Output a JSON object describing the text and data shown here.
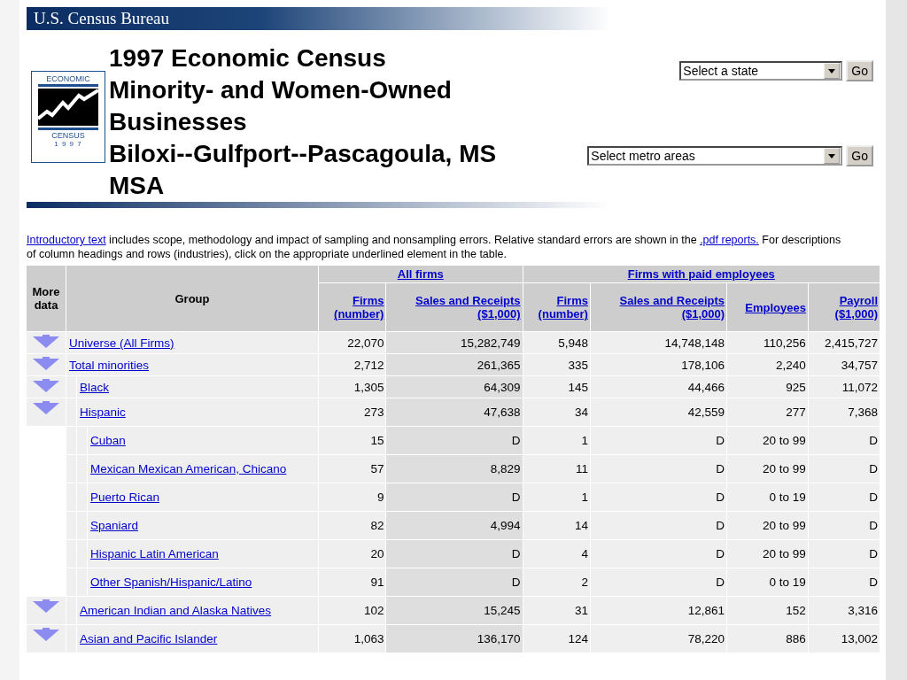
{
  "banner": {
    "title": "U.S. Census Bureau"
  },
  "logo": {
    "top": "ECONOMIC",
    "bottom": "CENSUS",
    "year": "1 9 9 7"
  },
  "title_lines": [
    "1997 Economic Census",
    "Minority- and Women-Owned",
    "Businesses",
    "Biloxi--Gulfport--Pascagoula, MS",
    "MSA"
  ],
  "selectors": [
    {
      "value": "Select a state",
      "button": "Go"
    },
    {
      "value": "Select metro areas",
      "button": "Go"
    }
  ],
  "intro": {
    "link1": "Introductory text",
    "text1": " includes scope, methodology and impact of sampling and nonsampling errors. Relative standard errors are shown in the ",
    "link2": ".pdf reports.",
    "text2": " For descriptions of column headings and rows (industries), click on the appropriate underlined element in the table."
  },
  "table": {
    "more_header": "More data",
    "group_header": "Group",
    "groups": [
      {
        "label": "All firms",
        "columns": [
          {
            "label": "Firms",
            "unit": "(number)"
          },
          {
            "label": "Sales and Receipts",
            "unit": "($1,000)"
          }
        ]
      },
      {
        "label": "Firms with paid employees",
        "columns": [
          {
            "label": "Firms",
            "unit": "(number)"
          },
          {
            "label": "Sales and Receipts",
            "unit": "($1,000)"
          },
          {
            "label": "Employees"
          },
          {
            "label": "Payroll",
            "unit": "($1,000)"
          }
        ]
      }
    ],
    "rows": [
      {
        "name": "Universe (All Firms)",
        "more_data": true,
        "values": [
          "22,070",
          "15,282,749",
          "5,948",
          "14,748,148",
          "110,256",
          "2,415,727"
        ]
      },
      {
        "name": "Total minorities",
        "more_data": true,
        "values": [
          "2,712",
          "261,365",
          "335",
          "178,106",
          "2,240",
          "34,757"
        ],
        "children": [
          {
            "name": "Black",
            "more_data": true,
            "values": [
              "1,305",
              "64,309",
              "145",
              "44,466",
              "925",
              "11,072"
            ]
          },
          {
            "name": "Hispanic",
            "more_data": true,
            "values": [
              "273",
              "47,638",
              "34",
              "42,559",
              "277",
              "7,368"
            ],
            "children": [
              {
                "name": "Cuban",
                "more_data": false,
                "values": [
                  "15",
                  "D",
                  "1",
                  "D",
                  "20 to 99",
                  "D"
                ]
              },
              {
                "name": "Mexican Mexican American, Chicano",
                "more_data": false,
                "values": [
                  "57",
                  "8,829",
                  "11",
                  "D",
                  "20 to 99",
                  "D"
                ]
              },
              {
                "name": "Puerto Rican",
                "more_data": false,
                "values": [
                  "9",
                  "D",
                  "1",
                  "D",
                  "0 to 19",
                  "D"
                ]
              },
              {
                "name": "Spaniard",
                "more_data": false,
                "values": [
                  "82",
                  "4,994",
                  "14",
                  "D",
                  "20 to 99",
                  "D"
                ]
              },
              {
                "name": "Hispanic Latin American",
                "more_data": false,
                "values": [
                  "20",
                  "D",
                  "4",
                  "D",
                  "20 to 99",
                  "D"
                ]
              },
              {
                "name": "Other Spanish/Hispanic/Latino",
                "more_data": false,
                "values": [
                  "91",
                  "D",
                  "2",
                  "D",
                  "0 to 19",
                  "D"
                ]
              }
            ]
          },
          {
            "name": "American Indian and Alaska Natives",
            "more_data": true,
            "values": [
              "102",
              "15,245",
              "31",
              "12,861",
              "152",
              "3,316"
            ]
          },
          {
            "name": "Asian and Pacific Islander",
            "more_data": true,
            "values": [
              "1,063",
              "136,170",
              "124",
              "78,220",
              "886",
              "13,002"
            ]
          }
        ]
      }
    ]
  }
}
